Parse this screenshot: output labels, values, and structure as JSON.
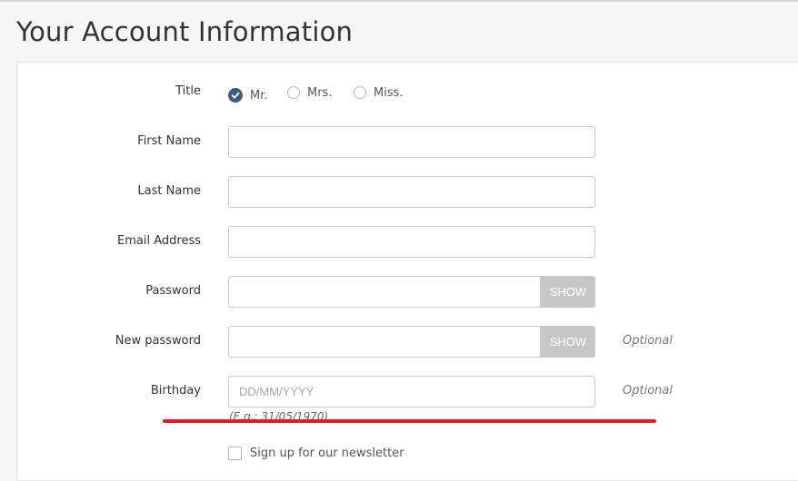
{
  "page_title": "Your Account Information",
  "form": {
    "title_label": "Title",
    "title_options": [
      {
        "label": "Mr.",
        "checked": true
      },
      {
        "label": "Mrs.",
        "checked": false
      },
      {
        "label": "Miss.",
        "checked": false
      }
    ],
    "first_name_label": "First Name",
    "first_name_value": "",
    "last_name_label": "Last Name",
    "last_name_value": "",
    "email_label": "Email Address",
    "email_value": "",
    "password_label": "Password",
    "password_show_label": "SHOW",
    "new_password_label": "New password",
    "new_password_show_label": "SHOW",
    "new_password_optional": "Optional",
    "birthday_label": "Birthday",
    "birthday_placeholder": "DD/MM/YYYY",
    "birthday_optional": "Optional",
    "birthday_hint": "(E.g.: 31/05/1970)",
    "newsletter_label": "Sign up for our newsletter",
    "newsletter_checked": false
  },
  "colors": {
    "radio_checked": "#3e5a7f",
    "show_button_bg": "#c7c7c7",
    "annotation_underline": "#e3192d"
  }
}
